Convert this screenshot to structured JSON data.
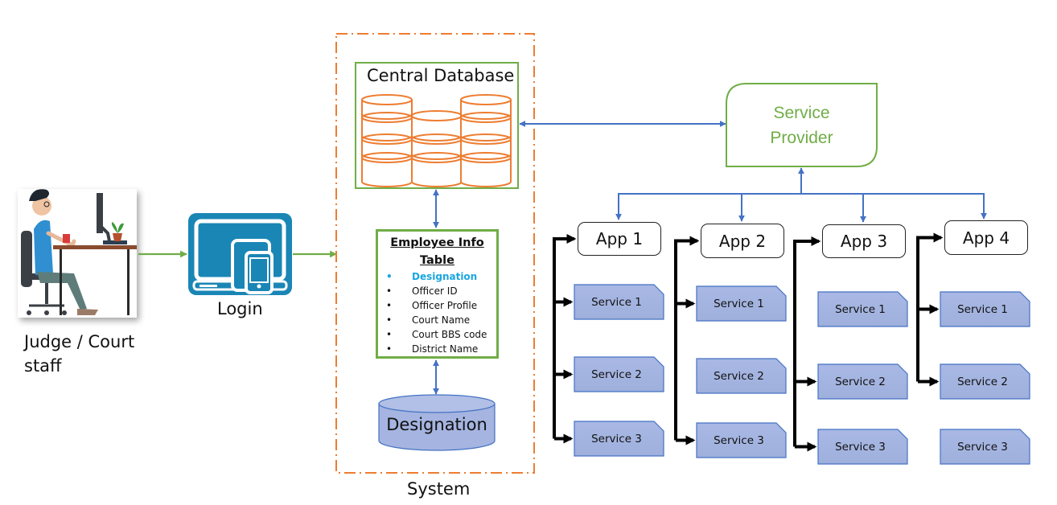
{
  "actor": {
    "label_line1": "Judge / Court",
    "label_line2": "staff",
    "icon": "person-at-desk-icon"
  },
  "login": {
    "label": "Login",
    "icon": "multi-device-icon",
    "color": "#1a86b5"
  },
  "system": {
    "label": "System",
    "border_color": "#ed7d31",
    "central_database": {
      "title": "Central Database",
      "icon": "database-cylinders-icon",
      "color": "#ed7d31"
    },
    "employee_table": {
      "title_line1": "Employee Info",
      "title_line2": "Table",
      "fields": [
        {
          "label": "Designation",
          "highlighted": true
        },
        {
          "label": "Officer ID",
          "highlighted": false
        },
        {
          "label": "Officer Profile",
          "highlighted": false
        },
        {
          "label": "Court Name",
          "highlighted": false
        },
        {
          "label": "Court BBS code",
          "highlighted": false
        },
        {
          "label": "District Name",
          "highlighted": false
        }
      ]
    },
    "designation_db": {
      "label": "Designation",
      "color": "#a5b4e0"
    }
  },
  "service_provider": {
    "line1": "Service",
    "line2": "Provider",
    "color": "#70ad47"
  },
  "apps": [
    {
      "label": "App 1",
      "services": [
        "Service 1",
        "Service 2",
        "Service 3"
      ],
      "connected": [
        true,
        true,
        true
      ]
    },
    {
      "label": "App 2",
      "services": [
        "Service 1",
        "Service 2",
        "Service 3"
      ],
      "connected": [
        true,
        false,
        true
      ]
    },
    {
      "label": "App 3",
      "services": [
        "Service 1",
        "Service 2",
        "Service 3"
      ],
      "connected": [
        false,
        true,
        true
      ]
    },
    {
      "label": "App 4",
      "services": [
        "Service 1",
        "Service 2",
        "Service 3"
      ],
      "connected": [
        true,
        true,
        false
      ]
    }
  ],
  "colors": {
    "green": "#70ad47",
    "blue_connector": "#4472c4",
    "service_fill": "#a5b4e0",
    "service_border": "#4472c4"
  }
}
